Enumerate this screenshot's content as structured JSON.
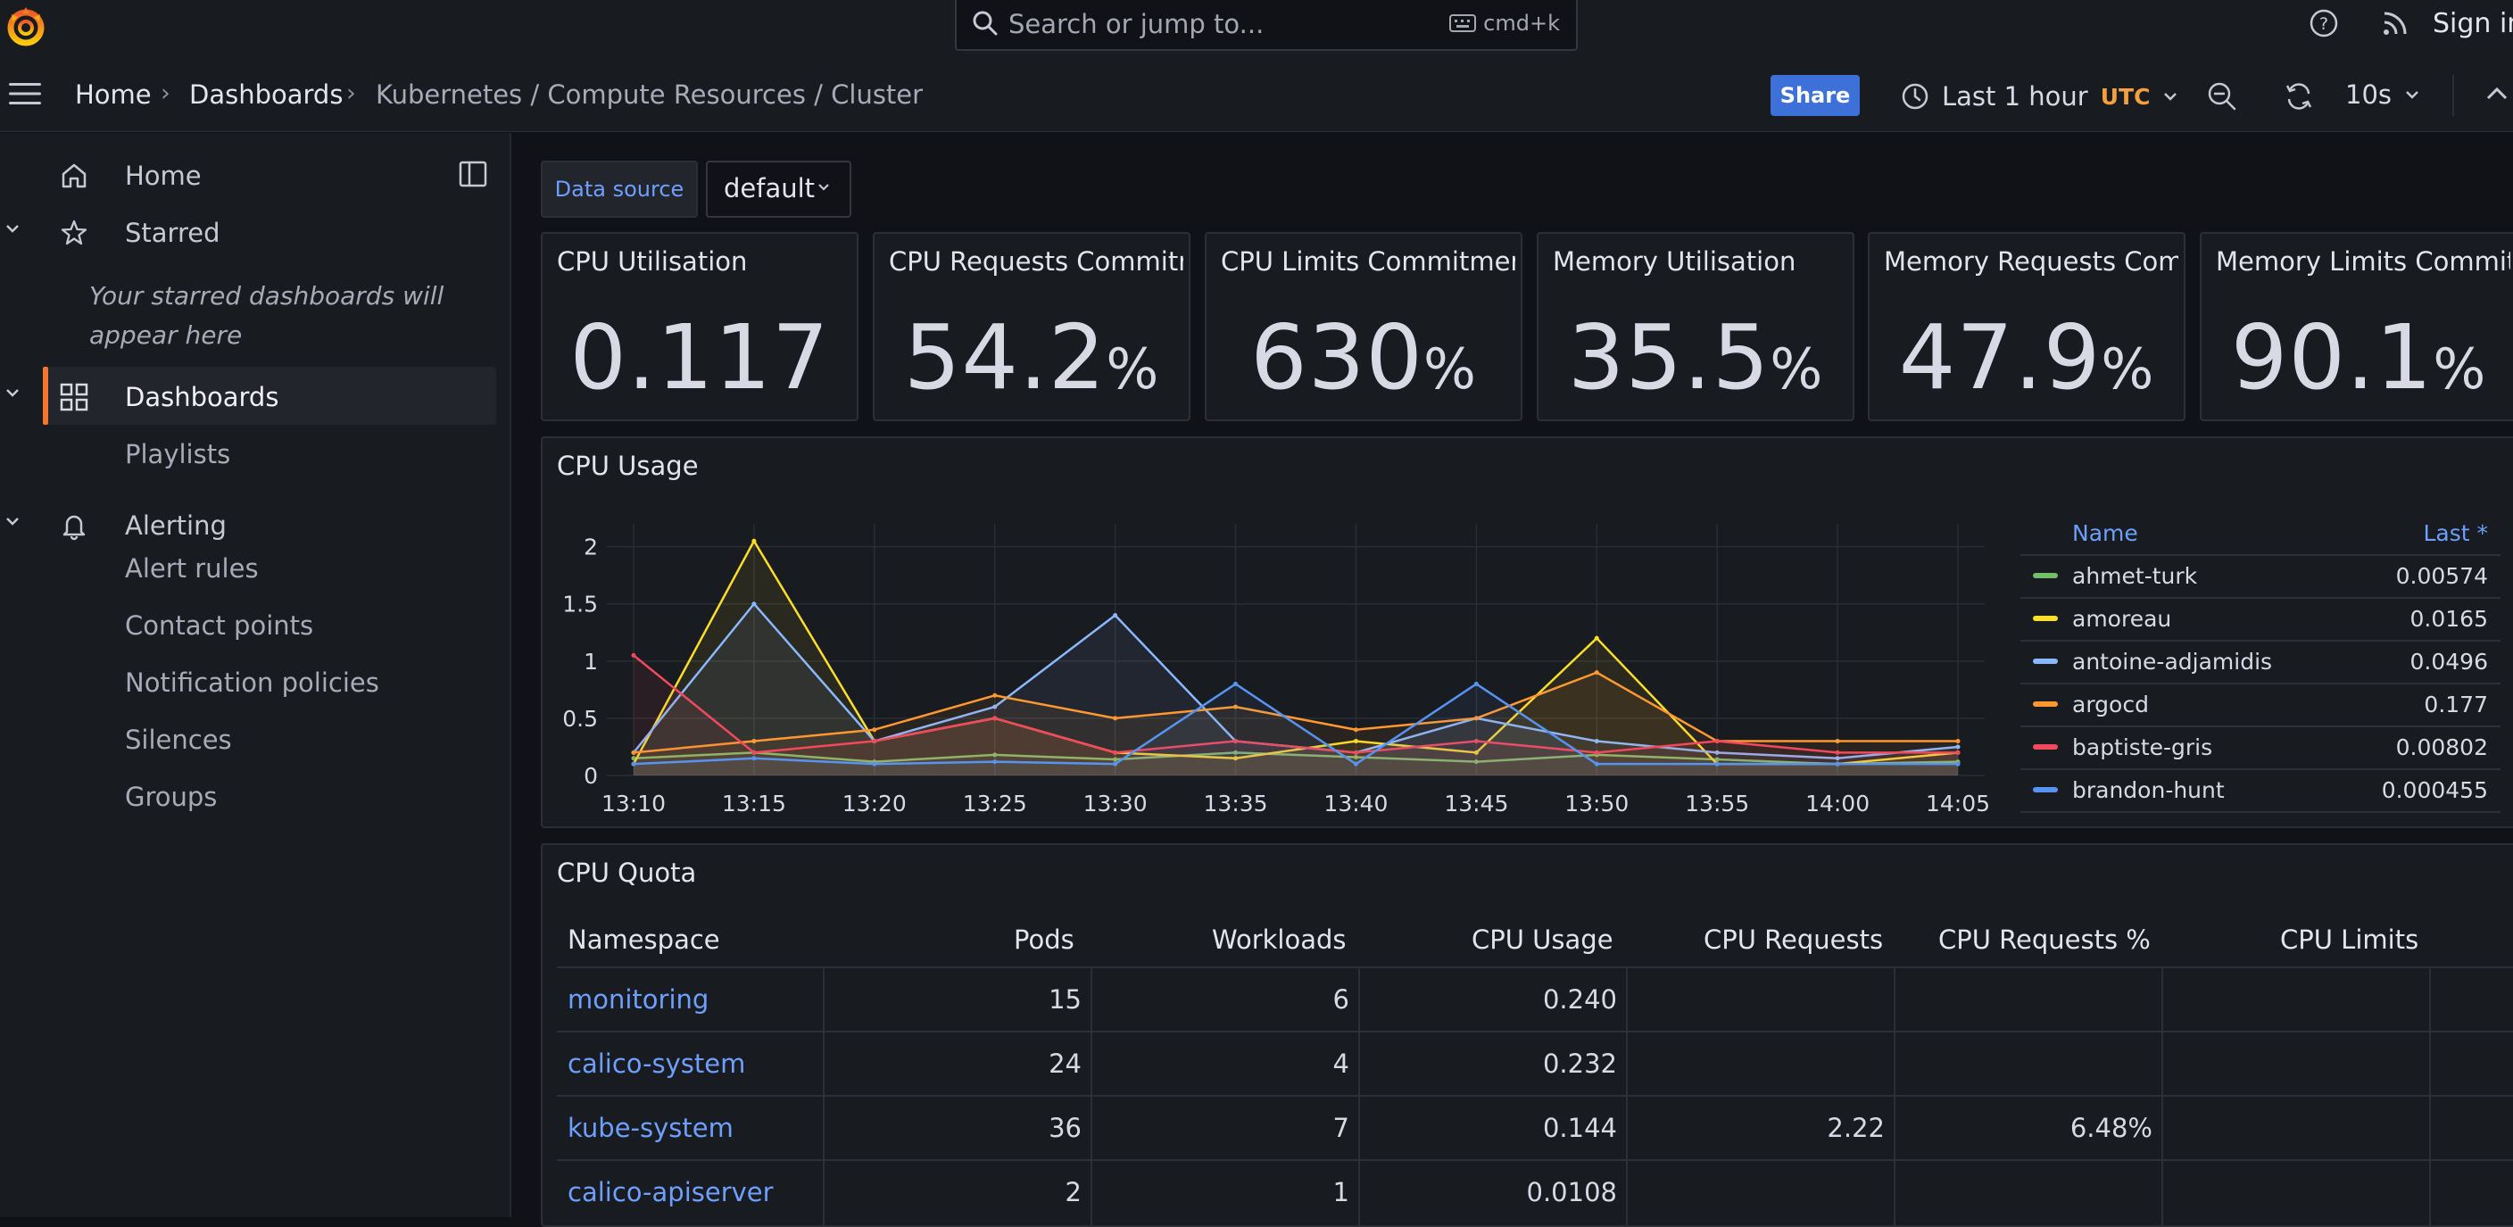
{
  "topbar": {
    "search_placeholder": "Search or jump to...",
    "search_shortcut": "cmd+k",
    "sign_in": "Sign in"
  },
  "breadcrumbs": [
    "Home",
    "Dashboards",
    "Kubernetes / Compute Resources / Cluster"
  ],
  "toolbar": {
    "share": "Share",
    "time_range": "Last 1 hour",
    "timezone": "UTC",
    "refresh_interval": "10s"
  },
  "sidebar": {
    "home": "Home",
    "starred": "Starred",
    "starred_note": "Your starred dashboards will appear here",
    "dashboards": "Dashboards",
    "playlists": "Playlists",
    "alerting": "Alerting",
    "alert_rules": "Alert rules",
    "contact_points": "Contact points",
    "notification_policies": "Notification policies",
    "silences": "Silences",
    "groups": "Groups"
  },
  "variables": {
    "datasource_label": "Data source",
    "datasource_value": "default"
  },
  "stats": [
    {
      "title": "CPU Utilisation",
      "value": "0.117",
      "unit": ""
    },
    {
      "title": "CPU Requests Commitment",
      "value": "54.2",
      "unit": "%"
    },
    {
      "title": "CPU Limits Commitment",
      "value": "630",
      "unit": "%"
    },
    {
      "title": "Memory Utilisation",
      "value": "35.5",
      "unit": "%"
    },
    {
      "title": "Memory Requests Commitment",
      "value": "47.9",
      "unit": "%"
    },
    {
      "title": "Memory Limits Commitment",
      "value": "90.1",
      "unit": "%"
    }
  ],
  "cpu_usage": {
    "title": "CPU Usage",
    "legend_header_name": "Name",
    "legend_header_last": "Last *",
    "legend": [
      {
        "name": "ahmet-turk",
        "last": "0.00574",
        "color": "#73bf69"
      },
      {
        "name": "amoreau",
        "last": "0.0165",
        "color": "#fade2a"
      },
      {
        "name": "antoine-adjamidis",
        "last": "0.0496",
        "color": "#8ab8ff"
      },
      {
        "name": "argocd",
        "last": "0.177",
        "color": "#ff9830"
      },
      {
        "name": "baptiste-gris",
        "last": "0.00802",
        "color": "#f2495c"
      },
      {
        "name": "brandon-hunt",
        "last": "0.000455",
        "color": "#5794f2"
      }
    ]
  },
  "chart_data": {
    "type": "line",
    "title": "CPU Usage",
    "x": [
      "13:10",
      "13:15",
      "13:20",
      "13:25",
      "13:30",
      "13:35",
      "13:40",
      "13:45",
      "13:50",
      "13:55",
      "14:00",
      "14:05"
    ],
    "ylim": [
      0,
      2.2
    ],
    "yticks": [
      0,
      0.5,
      1,
      1.5,
      2
    ],
    "grid": true,
    "legend_position": "right",
    "series": [
      {
        "name": "ahmet-turk",
        "color": "#73bf69",
        "values": [
          0.15,
          0.2,
          0.12,
          0.18,
          0.14,
          0.2,
          0.16,
          0.12,
          0.18,
          0.14,
          0.1,
          0.12
        ]
      },
      {
        "name": "amoreau",
        "color": "#fade2a",
        "values": [
          0.1,
          2.05,
          0.3,
          0.5,
          0.2,
          0.15,
          0.3,
          0.2,
          1.2,
          0.1,
          0.1,
          0.2
        ]
      },
      {
        "name": "antoine-adjamidis",
        "color": "#8ab8ff",
        "values": [
          0.2,
          1.5,
          0.3,
          0.6,
          1.4,
          0.3,
          0.2,
          0.5,
          0.3,
          0.2,
          0.15,
          0.25
        ]
      },
      {
        "name": "argocd",
        "color": "#ff9830",
        "values": [
          0.2,
          0.3,
          0.4,
          0.7,
          0.5,
          0.6,
          0.4,
          0.5,
          0.9,
          0.3,
          0.3,
          0.3
        ]
      },
      {
        "name": "baptiste-gris",
        "color": "#f2495c",
        "values": [
          1.05,
          0.2,
          0.3,
          0.5,
          0.2,
          0.3,
          0.2,
          0.3,
          0.2,
          0.3,
          0.2,
          0.2
        ]
      },
      {
        "name": "brandon-hunt",
        "color": "#5794f2",
        "values": [
          0.1,
          0.15,
          0.1,
          0.12,
          0.1,
          0.8,
          0.1,
          0.8,
          0.1,
          0.1,
          0.1,
          0.1
        ]
      }
    ]
  },
  "cpu_quota": {
    "title": "CPU Quota",
    "columns": [
      "Namespace",
      "Pods",
      "Workloads",
      "CPU Usage",
      "CPU Requests",
      "CPU Requests %",
      "CPU Limits"
    ],
    "rows": [
      {
        "namespace": "monitoring",
        "pods": "15",
        "workloads": "6",
        "cpu_usage": "0.240",
        "cpu_requests": "",
        "cpu_requests_pct": "",
        "cpu_limits": ""
      },
      {
        "namespace": "calico-system",
        "pods": "24",
        "workloads": "4",
        "cpu_usage": "0.232",
        "cpu_requests": "",
        "cpu_requests_pct": "",
        "cpu_limits": ""
      },
      {
        "namespace": "kube-system",
        "pods": "36",
        "workloads": "7",
        "cpu_usage": "0.144",
        "cpu_requests": "2.22",
        "cpu_requests_pct": "6.48%",
        "cpu_limits": ""
      },
      {
        "namespace": "calico-apiserver",
        "pods": "2",
        "workloads": "1",
        "cpu_usage": "0.0108",
        "cpu_requests": "",
        "cpu_requests_pct": "",
        "cpu_limits": ""
      }
    ]
  }
}
